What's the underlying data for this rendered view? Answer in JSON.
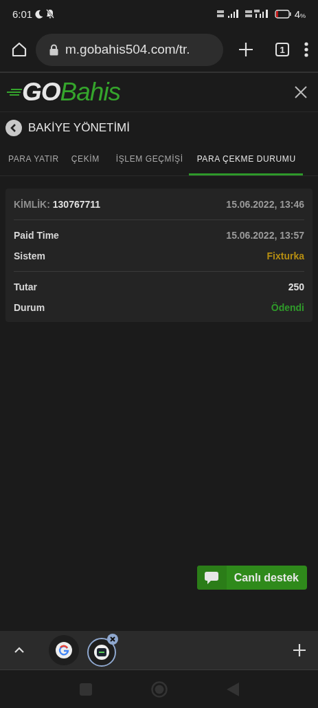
{
  "status_bar": {
    "time": "6:01",
    "battery_percent": "4",
    "battery_unit": "%"
  },
  "browser": {
    "url": "m.gobahis504.com/tr.",
    "tab_count": "1"
  },
  "header": {
    "logo_bold": "GO",
    "logo_light": "Bahis"
  },
  "page_title": "BAKİYE YÖNETİMİ",
  "tabs": [
    {
      "label": "PARA YATIR",
      "selected": false
    },
    {
      "label": "ÇEKİM",
      "selected": false
    },
    {
      "label": "İŞLEM GEÇMİŞİ",
      "selected": false
    },
    {
      "label": "PARA ÇEKME DURUMU",
      "selected": true
    }
  ],
  "card": {
    "id_label": "KİMLİK:",
    "id_value": "130767711",
    "date": "15.06.2022, 13:46",
    "groups": [
      [
        {
          "label": "Paid Time",
          "value": "15.06.2022, 13:57",
          "color": "#9a9a9a"
        },
        {
          "label": "Sistem",
          "value": "Fixturka",
          "color": "#b58d12"
        }
      ],
      [
        {
          "label": "Tutar",
          "value": "250",
          "color": "#e0e0e0"
        },
        {
          "label": "Durum",
          "value": "Ödendi",
          "color": "#2f9a2a"
        }
      ]
    ]
  },
  "chat_button": {
    "label": "Canlı destek"
  }
}
